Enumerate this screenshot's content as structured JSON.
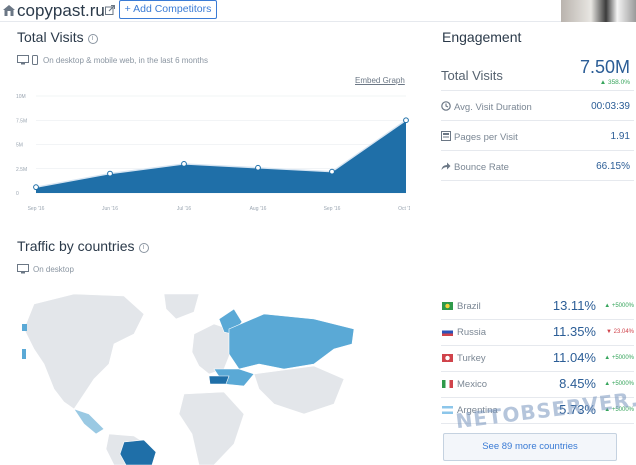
{
  "header": {
    "site_name": "copypast.ru",
    "add_competitors": "+ Add Competitors"
  },
  "total_visits_section": {
    "title": "Total Visits",
    "note": "On desktop & mobile web, in the last 6 months",
    "embed_link": "Embed Graph"
  },
  "chart_data": {
    "type": "area",
    "categories": [
      "Sep '16",
      "Jun '16",
      "Jul '16",
      "Aug '16",
      "Sep '16",
      "Oct '16"
    ],
    "values": [
      0.6,
      2.0,
      3.0,
      2.6,
      2.2,
      7.5
    ],
    "y_ticks": [
      "10M",
      "7.5M",
      "5M",
      "2.5M",
      "0"
    ],
    "y_tick_values": [
      10,
      7.5,
      5,
      2.5,
      0
    ],
    "ylim": [
      0,
      10
    ],
    "grid": true,
    "color": "#1f6fa8"
  },
  "engagement": {
    "title": "Engagement",
    "total_visits_label": "Total Visits",
    "total_visits_value": "7.50M",
    "total_visits_change": "358.0%",
    "rows": [
      {
        "label": "Avg. Visit Duration",
        "value": "00:03:39",
        "icon": "clock-icon"
      },
      {
        "label": "Pages per Visit",
        "value": "1.91",
        "icon": "pages-icon"
      },
      {
        "label": "Bounce Rate",
        "value": "66.15%",
        "icon": "bounce-arrow-icon"
      }
    ]
  },
  "traffic_section": {
    "title": "Traffic by countries",
    "note": "On desktop"
  },
  "countries": [
    {
      "name": "Brazil",
      "pct": "13.11%",
      "change": "+5000%",
      "dir": "up"
    },
    {
      "name": "Russia",
      "pct": "11.35%",
      "change": "23.04%",
      "dir": "down"
    },
    {
      "name": "Turkey",
      "pct": "11.04%",
      "change": "+5000%",
      "dir": "up"
    },
    {
      "name": "Mexico",
      "pct": "8.45%",
      "change": "+5000%",
      "dir": "up"
    },
    {
      "name": "Argentina",
      "pct": "5.73%",
      "change": "+5000%",
      "dir": "up"
    }
  ],
  "more_countries": "See 89 more countries",
  "watermark": "NETOBSERVER.RU",
  "colors": {
    "accent": "#3a7bd5",
    "value_blue": "#2b5d96",
    "map_highlight": "#5aa9d6",
    "map_base": "#e3e6ea",
    "up": "#37a55c",
    "down": "#d0434b"
  }
}
